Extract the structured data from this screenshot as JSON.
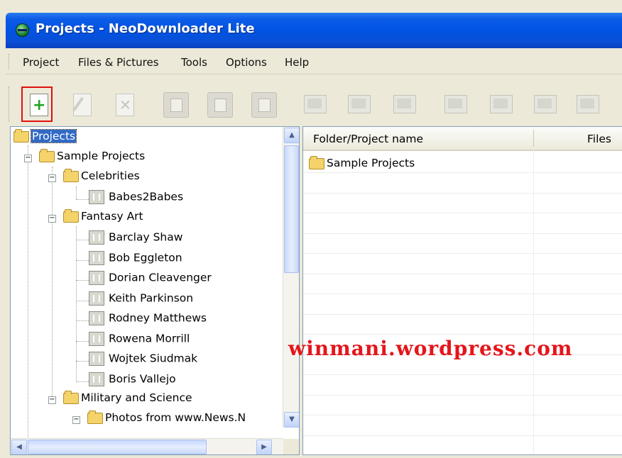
{
  "window": {
    "title": "Projects - NeoDownloader Lite"
  },
  "menu": {
    "items": [
      "Project",
      "Files & Pictures",
      "Tools",
      "Options",
      "Help"
    ]
  },
  "toolbar": {
    "buttons": [
      "new-project-icon",
      "edit-project-icon",
      "delete-project-icon",
      "start-icon",
      "pause-icon",
      "stop-icon",
      "previous-picture-icon",
      "next-picture-icon",
      "slideshow-icon",
      "picture-icon",
      "delete-picture-icon",
      "picture-properties-icon",
      "thumbnails-icon"
    ]
  },
  "tree": {
    "root": "Projects",
    "sample_projects": "Sample Projects",
    "celebrities": "Celebrities",
    "babes2babes": "Babes2Babes",
    "fantasy_art": "Fantasy Art",
    "fantasy_items": [
      "Barclay Shaw",
      "Bob Eggleton",
      "Dorian Cleavenger",
      "Keith Parkinson",
      "Rodney Matthews",
      "Rowena Morrill",
      "Wojtek Siudmak",
      "Boris Vallejo"
    ],
    "military": "Military and Science",
    "photos": "Photos from www.News.N"
  },
  "list": {
    "columns": {
      "name": "Folder/Project name",
      "files": "Files"
    },
    "rows": [
      {
        "name": "Sample Projects"
      }
    ]
  },
  "watermark": "winmani.wordpress.com",
  "colors": {
    "titlebar": "#0054e3",
    "selection": "#316ac5",
    "highlight_border": "#e01010",
    "watermark": "#e3161c"
  }
}
